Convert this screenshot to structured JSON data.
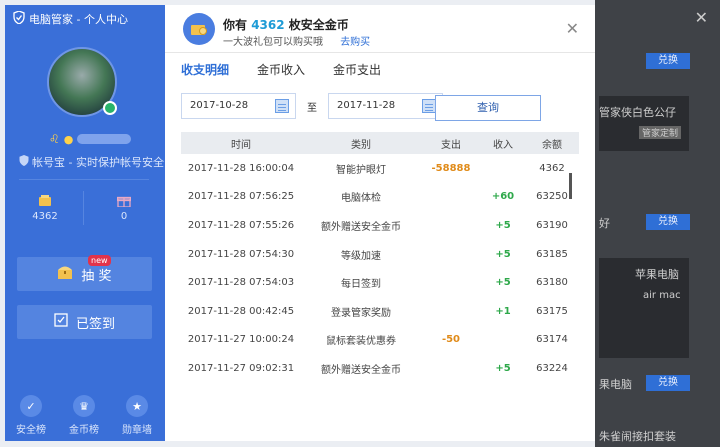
{
  "left_panel": {
    "title": "电脑管家 - 个人中心",
    "protect_text": "帐号宝 - 实时保护帐号安全",
    "stats": [
      {
        "icon": "coin-stack-icon",
        "value": "4362"
      },
      {
        "icon": "gift-icon",
        "value": "0"
      }
    ],
    "lottery_label": "抽 奖",
    "new_badge": "new",
    "checkin_label": "已签到",
    "bottom_nav": [
      {
        "icon": "shield-icon",
        "label": "安全榜"
      },
      {
        "icon": "crown-icon",
        "label": "金币榜"
      },
      {
        "icon": "medal-icon",
        "label": "勋章墙"
      }
    ]
  },
  "header": {
    "prefix": "你有",
    "coins": "4362",
    "suffix": "枚安全金币",
    "subtitle": "一大波礼包可以购买哦",
    "buy_link": "去购买"
  },
  "tabs": [
    {
      "label": "收支明细",
      "active": true
    },
    {
      "label": "金币收入",
      "active": false
    },
    {
      "label": "金币支出",
      "active": false
    }
  ],
  "filter": {
    "start_date": "2017-10-28",
    "to_label": "至",
    "end_date": "2017-11-28",
    "query_label": "查询"
  },
  "table": {
    "columns": [
      "时间",
      "类别",
      "支出",
      "收入",
      "余额"
    ],
    "rows": [
      {
        "time": "2017-11-28 16:00:04",
        "type": "智能护眼灯",
        "out": "-58888",
        "in": "",
        "balance": "4362"
      },
      {
        "time": "2017-11-28 07:56:25",
        "type": "电脑体检",
        "out": "",
        "in": "+60",
        "balance": "63250"
      },
      {
        "time": "2017-11-28 07:55:26",
        "type": "额外赠送安全金币",
        "out": "",
        "in": "+5",
        "balance": "63190"
      },
      {
        "time": "2017-11-28 07:54:30",
        "type": "等级加速",
        "out": "",
        "in": "+5",
        "balance": "63185"
      },
      {
        "time": "2017-11-28 07:54:03",
        "type": "每日签到",
        "out": "",
        "in": "+5",
        "balance": "63180"
      },
      {
        "time": "2017-11-28 00:42:45",
        "type": "登录管家奖励",
        "out": "",
        "in": "+1",
        "balance": "63175"
      },
      {
        "time": "2017-11-27 10:00:24",
        "type": "鼠标套装优惠券",
        "out": "-50",
        "in": "",
        "balance": "63174"
      },
      {
        "time": "2017-11-27 09:02:31",
        "type": "额外赠送安全金币",
        "out": "",
        "in": "+5",
        "balance": "63224"
      }
    ]
  },
  "background": {
    "button_label": "兑换",
    "text1": "管家侠白色公仔",
    "text2": "管家定制",
    "text3": "苹果电脑",
    "text4": "air mac",
    "text5": "果电脑",
    "text6": "好",
    "text7": "朱雀闹接扣套装"
  }
}
